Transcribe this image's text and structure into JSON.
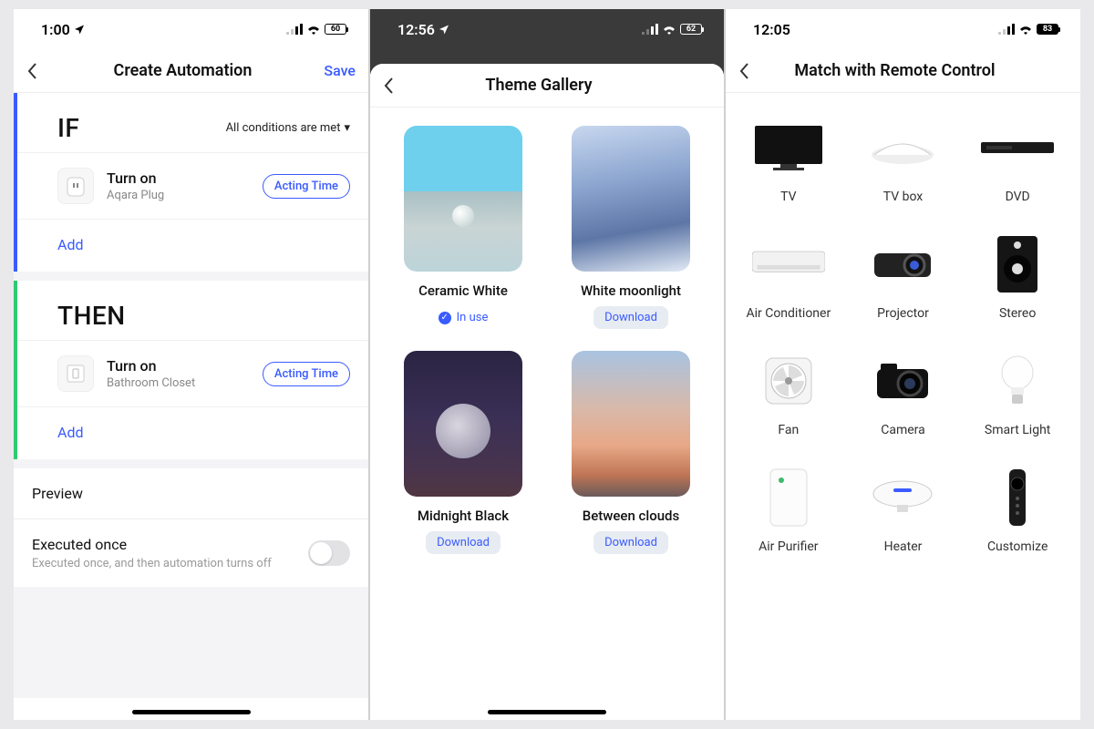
{
  "screen1": {
    "status": {
      "time": "1:00",
      "battery": "60"
    },
    "nav": {
      "title": "Create Automation",
      "save": "Save"
    },
    "if": {
      "title": "IF",
      "condition_mode": "All conditions are met",
      "items": [
        {
          "action": "Turn on",
          "device": "Aqara Plug",
          "pill": "Acting Time"
        }
      ],
      "add_label": "Add"
    },
    "then": {
      "title": "THEN",
      "items": [
        {
          "action": "Turn on",
          "device": "Bathroom Closet",
          "pill": "Acting Time"
        }
      ],
      "add_label": "Add"
    },
    "preview_label": "Preview",
    "exec_once": {
      "title": "Executed once",
      "sub": "Executed once, and then automation turns off"
    }
  },
  "screen2": {
    "status": {
      "time": "12:56",
      "battery": "62"
    },
    "nav": {
      "title": "Theme Gallery"
    },
    "themes": [
      {
        "name": "Ceramic White",
        "status": "in_use",
        "status_label": "In use",
        "thumb": "ceramic"
      },
      {
        "name": "White moonlight",
        "status": "download",
        "status_label": "Download",
        "thumb": "moonlight"
      },
      {
        "name": "Midnight Black",
        "status": "download",
        "status_label": "Download",
        "thumb": "midnight"
      },
      {
        "name": "Between clouds",
        "status": "download",
        "status_label": "Download",
        "thumb": "clouds"
      }
    ]
  },
  "screen3": {
    "status": {
      "time": "12:05",
      "battery": "83"
    },
    "nav": {
      "title": "Match with Remote Control"
    },
    "devices": [
      {
        "label": "TV",
        "icon": "tv"
      },
      {
        "label": "TV box",
        "icon": "tvbox"
      },
      {
        "label": "DVD",
        "icon": "dvd"
      },
      {
        "label": "Air Conditioner",
        "icon": "ac"
      },
      {
        "label": "Projector",
        "icon": "projector"
      },
      {
        "label": "Stereo",
        "icon": "stereo"
      },
      {
        "label": "Fan",
        "icon": "fan"
      },
      {
        "label": "Camera",
        "icon": "camera"
      },
      {
        "label": "Smart Light",
        "icon": "bulb"
      },
      {
        "label": "Air Purifier",
        "icon": "purifier"
      },
      {
        "label": "Heater",
        "icon": "heater"
      },
      {
        "label": "Customize",
        "icon": "remote"
      }
    ]
  }
}
